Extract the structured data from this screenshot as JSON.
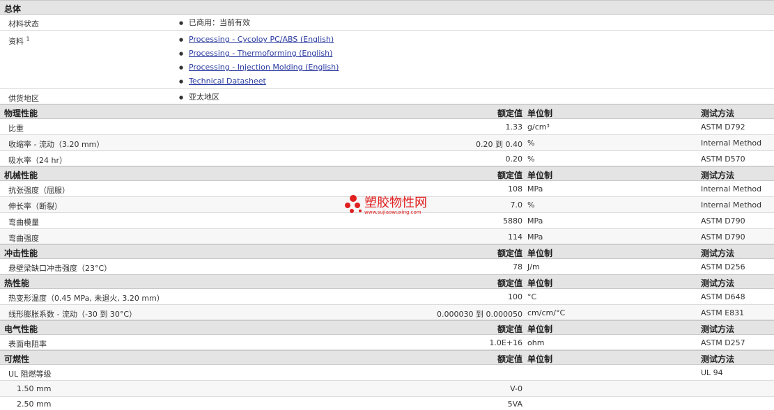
{
  "watermark": {
    "text": "塑胶物性网",
    "url_text": "www.sujiaowuxing.com"
  },
  "general": {
    "title": "总体",
    "status_label": "材料状态",
    "status_value": "已商用：当前有效",
    "docs_label": "资料",
    "docs_sup": "1",
    "docs": [
      "Processing - Cycoloy PC/ABS (English)",
      "Processing - Thermoforming (English)",
      "Processing - Injection Molding (English)",
      "Technical Datasheet"
    ],
    "region_label": "供货地区",
    "region_value": "亚太地区"
  },
  "headers": {
    "value": "额定值",
    "unit": "单位制",
    "method": "测试方法"
  },
  "sections": [
    {
      "title": "物理性能",
      "rows": [
        {
          "label": "比重",
          "value": "1.33",
          "unit": "g/cm³",
          "method": "ASTM D792"
        },
        {
          "label": "收缩率  - 流动（3.20 mm）",
          "value": "0.20 到  0.40",
          "unit": "%",
          "method": "Internal Method"
        },
        {
          "label": "吸水率（24 hr）",
          "value": "0.20",
          "unit": "%",
          "method": "ASTM D570"
        }
      ]
    },
    {
      "title": "机械性能",
      "rows": [
        {
          "label": "抗张强度（屈服）",
          "value": "108",
          "unit": "MPa",
          "method": "Internal Method"
        },
        {
          "label": "伸长率（断裂）",
          "value": "7.0",
          "unit": "%",
          "method": "Internal Method"
        },
        {
          "label": "弯曲模量",
          "value": "5880",
          "unit": "MPa",
          "method": "ASTM D790"
        },
        {
          "label": "弯曲强度",
          "value": "114",
          "unit": "MPa",
          "method": "ASTM D790"
        }
      ]
    },
    {
      "title": "冲击性能",
      "rows": [
        {
          "label": "悬壁梁缺口冲击强度（23°C）",
          "value": "78",
          "unit": "J/m",
          "method": "ASTM D256"
        }
      ]
    },
    {
      "title": "热性能",
      "rows": [
        {
          "label": "热变形温度（0.45 MPa, 未退火, 3.20 mm）",
          "value": "100",
          "unit": "°C",
          "method": "ASTM D648"
        },
        {
          "label": "线形膨胀系数  - 流动（-30 到  30°C）",
          "value": "0.000030 到  0.000050",
          "unit": "cm/cm/°C",
          "method": "ASTM E831"
        }
      ]
    },
    {
      "title": "电气性能",
      "rows": [
        {
          "label": "表面电阻率",
          "value": "1.0E+16",
          "unit": "ohm",
          "method": "ASTM D257"
        }
      ]
    },
    {
      "title": "可燃性",
      "rows": [
        {
          "label": "UL 阻燃等级",
          "value": "",
          "unit": "",
          "method": "UL 94"
        },
        {
          "label": "1.50 mm",
          "value": "V-0",
          "unit": "",
          "method": "",
          "indent": true
        },
        {
          "label": "2.50 mm",
          "value": "5VA",
          "unit": "",
          "method": "",
          "indent": true
        }
      ]
    }
  ]
}
